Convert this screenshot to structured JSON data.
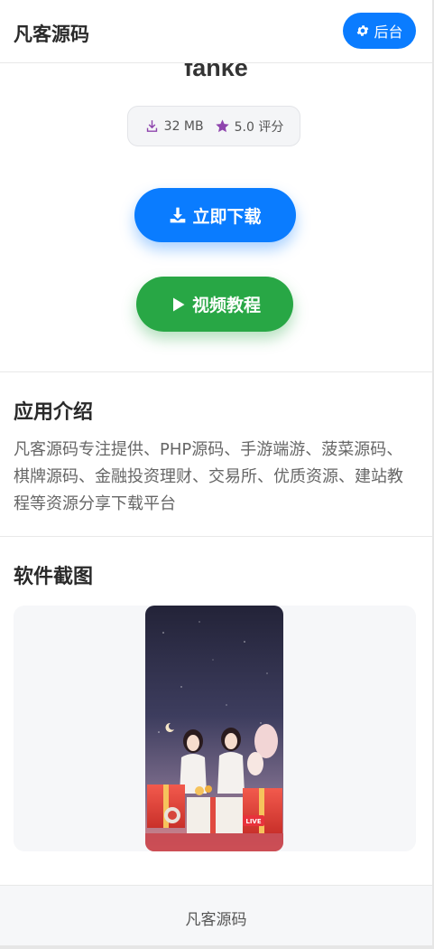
{
  "header": {
    "site_title": "凡客源码",
    "admin_button": {
      "label": "后台",
      "icon": "gear-icon"
    }
  },
  "app": {
    "name": "fanke",
    "size": "32 MB",
    "rating": "5.0 评分",
    "size_icon": "download-icon",
    "rating_icon": "star-icon"
  },
  "actions": {
    "download_label": "立即下载",
    "video_label": "视频教程"
  },
  "intro": {
    "title": "应用介绍",
    "text": "凡客源码专注提供、PHP源码、手游端游、菠菜源码、棋牌源码、金融投资理财、交易所、优质资源、建站教程等资源分享下载平台"
  },
  "screenshots": {
    "title": "软件截图",
    "live_badge": "LIVE"
  },
  "footer": {
    "text": "凡客源码"
  },
  "colors": {
    "primary": "#0a7cff",
    "success": "#28a745",
    "meta_icon": "#8e44ad"
  }
}
